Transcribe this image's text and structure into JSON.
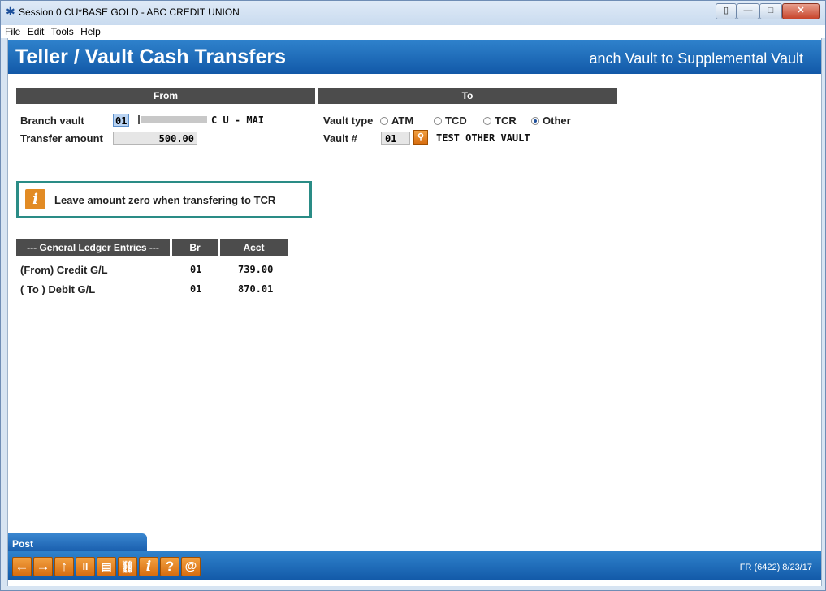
{
  "window": {
    "title": "Session 0 CU*BASE GOLD - ABC CREDIT UNION",
    "controls": [
      "▯",
      "—",
      "□",
      "✕"
    ]
  },
  "menu": [
    "File",
    "Edit",
    "Tools",
    "Help"
  ],
  "header": {
    "title": "Teller / Vault Cash Transfers",
    "subtitle": "anch Vault to Supplemental Vault"
  },
  "from": {
    "header": "From",
    "branch_vault_label": "Branch vault",
    "branch_vault_value": "01",
    "branch_vault_name": "C U - MAI",
    "transfer_amount_label": "Transfer amount",
    "transfer_amount_value": "500.00"
  },
  "to": {
    "header": "To",
    "vault_type_label": "Vault type",
    "vault_types": [
      {
        "label": "ATM",
        "selected": false
      },
      {
        "label": "TCD",
        "selected": false
      },
      {
        "label": "TCR",
        "selected": false
      },
      {
        "label": "Other",
        "selected": true
      }
    ],
    "vault_number_label": "Vault #",
    "vault_number_value": "01",
    "vault_name": "TEST OTHER VAULT"
  },
  "info": {
    "icon": "i",
    "message": "Leave amount zero when transfering to TCR"
  },
  "gl": {
    "headers": [
      "--- General Ledger Entries ---",
      "Br",
      "Acct"
    ],
    "rows": [
      {
        "label": "(From) Credit G/L",
        "br": "01",
        "acct": "739.00"
      },
      {
        "label": "( To ) Debit G/L",
        "br": "01",
        "acct": "870.01"
      }
    ]
  },
  "actions": {
    "post_label": "Post"
  },
  "toolbar": {
    "icons": [
      "back-arrow",
      "forward-arrow",
      "up-arrow",
      "pause",
      "print",
      "link",
      "info",
      "help",
      "at-sign"
    ],
    "glyphs": [
      "←",
      "→",
      "↑",
      "II",
      "▤",
      "⛓",
      "i",
      "?",
      "@"
    ]
  },
  "footer": {
    "code": "FR (6422) 8/23/17"
  },
  "colors": {
    "header_blue": "#1f6fbd",
    "accent_orange": "#e28b24",
    "info_border": "#2a8c86"
  }
}
